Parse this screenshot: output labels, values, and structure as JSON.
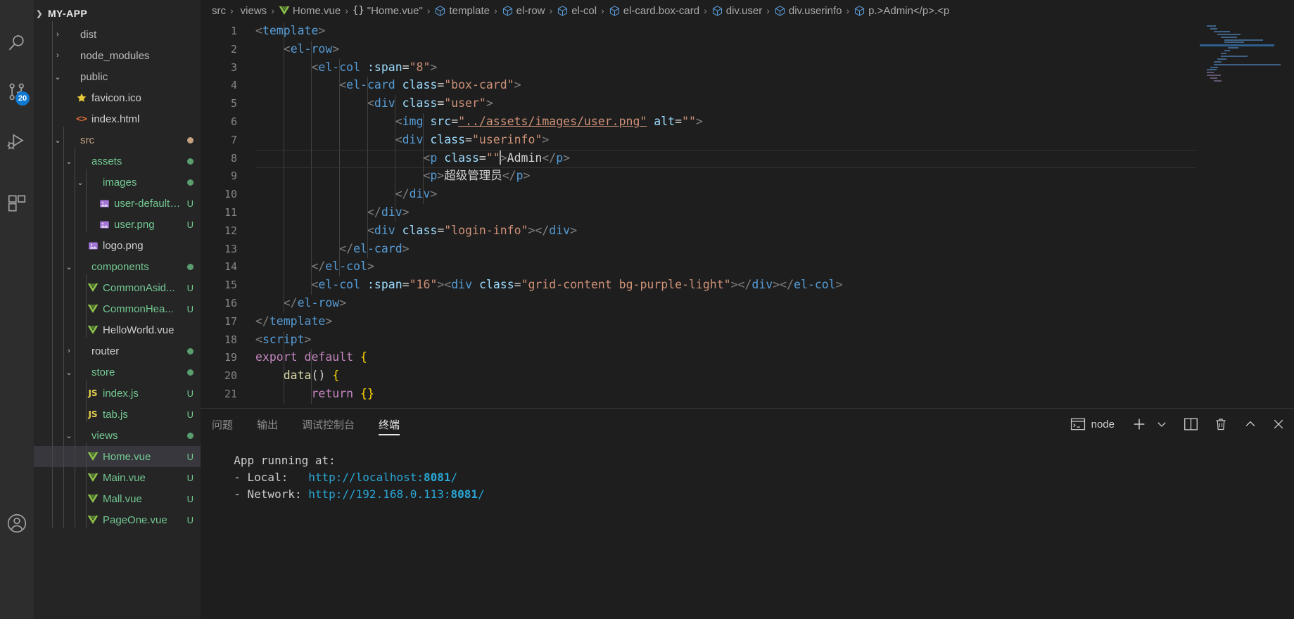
{
  "activity_bar": {
    "items": [
      {
        "name": "explorer",
        "icon": "files-icon",
        "badge": ""
      },
      {
        "name": "search",
        "icon": "search-icon",
        "badge": ""
      },
      {
        "name": "source-control",
        "icon": "source-control-icon",
        "badge": "20"
      },
      {
        "name": "run-and-debug",
        "icon": "run-debug-icon",
        "badge": ""
      },
      {
        "name": "extensions",
        "icon": "extensions-icon",
        "badge": ""
      }
    ],
    "account": {
      "name": "account",
      "icon": "account-icon"
    }
  },
  "explorer": {
    "root_label": "MY-APP",
    "items": [
      {
        "label": "dist",
        "indent": 1,
        "twisty": "collapsed",
        "icon": "folder-icon",
        "color": "#bdbdbd",
        "git": "",
        "dot": ""
      },
      {
        "label": "node_modules",
        "indent": 1,
        "twisty": "collapsed",
        "icon": "folder-icon",
        "color": "#bdbdbd",
        "git": "",
        "dot": ""
      },
      {
        "label": "public",
        "indent": 1,
        "twisty": "expanded",
        "icon": "folder-icon",
        "color": "#bdbdbd",
        "git": "",
        "dot": ""
      },
      {
        "label": "favicon.ico",
        "indent": 2,
        "twisty": "none",
        "icon": "star-icon",
        "color": "#cfcfcf",
        "git": "",
        "dot": ""
      },
      {
        "label": "index.html",
        "indent": 2,
        "twisty": "none",
        "icon": "html-icon",
        "color": "#cfcfcf",
        "git": "",
        "dot": ""
      },
      {
        "label": "src",
        "indent": 1,
        "twisty": "expanded",
        "icon": "folder-icon",
        "color": "#c5a180",
        "git": "",
        "dot": "#c5a180"
      },
      {
        "label": "assets",
        "indent": 2,
        "twisty": "expanded",
        "icon": "folder-icon",
        "color": "#73c991",
        "git": "",
        "dot": "#5a9e6f"
      },
      {
        "label": "images",
        "indent": 3,
        "twisty": "expanded",
        "icon": "folder-icon",
        "color": "#73c991",
        "git": "",
        "dot": "#5a9e6f"
      },
      {
        "label": "user-default....",
        "indent": 4,
        "twisty": "none",
        "icon": "image-icon",
        "color": "#73c991",
        "git": "U",
        "dot": ""
      },
      {
        "label": "user.png",
        "indent": 4,
        "twisty": "none",
        "icon": "image-icon",
        "color": "#73c991",
        "git": "U",
        "dot": ""
      },
      {
        "label": "logo.png",
        "indent": 3,
        "twisty": "none",
        "icon": "image-icon",
        "color": "#cfcfcf",
        "git": "",
        "dot": ""
      },
      {
        "label": "components",
        "indent": 2,
        "twisty": "expanded",
        "icon": "folder-icon",
        "color": "#73c991",
        "git": "",
        "dot": "#5a9e6f"
      },
      {
        "label": "CommonAsid...",
        "indent": 3,
        "twisty": "none",
        "icon": "vue-icon",
        "color": "#73c991",
        "git": "U",
        "dot": ""
      },
      {
        "label": "CommonHea...",
        "indent": 3,
        "twisty": "none",
        "icon": "vue-icon",
        "color": "#73c991",
        "git": "U",
        "dot": ""
      },
      {
        "label": "HelloWorld.vue",
        "indent": 3,
        "twisty": "none",
        "icon": "vue-icon",
        "color": "#cfcfcf",
        "git": "",
        "dot": ""
      },
      {
        "label": "router",
        "indent": 2,
        "twisty": "collapsed",
        "icon": "folder-icon",
        "color": "#cfcfcf",
        "git": "",
        "dot": "#5a9e6f"
      },
      {
        "label": "store",
        "indent": 2,
        "twisty": "expanded",
        "icon": "folder-icon",
        "color": "#73c991",
        "git": "",
        "dot": "#5a9e6f"
      },
      {
        "label": "index.js",
        "indent": 3,
        "twisty": "none",
        "icon": "js-icon",
        "color": "#73c991",
        "git": "U",
        "dot": ""
      },
      {
        "label": "tab.js",
        "indent": 3,
        "twisty": "none",
        "icon": "js-icon",
        "color": "#73c991",
        "git": "U",
        "dot": ""
      },
      {
        "label": "views",
        "indent": 2,
        "twisty": "expanded",
        "icon": "folder-icon",
        "color": "#73c991",
        "git": "",
        "dot": "#5a9e6f"
      },
      {
        "label": "Home.vue",
        "indent": 3,
        "twisty": "none",
        "icon": "vue-icon",
        "color": "#73c991",
        "git": "U",
        "dot": "",
        "selected": true
      },
      {
        "label": "Main.vue",
        "indent": 3,
        "twisty": "none",
        "icon": "vue-icon",
        "color": "#73c991",
        "git": "U",
        "dot": ""
      },
      {
        "label": "Mall.vue",
        "indent": 3,
        "twisty": "none",
        "icon": "vue-icon",
        "color": "#73c991",
        "git": "U",
        "dot": ""
      },
      {
        "label": "PageOne.vue",
        "indent": 3,
        "twisty": "none",
        "icon": "vue-icon",
        "color": "#73c991",
        "git": "U",
        "dot": ""
      }
    ]
  },
  "breadcrumb": [
    {
      "label": "src",
      "icon": ""
    },
    {
      "label": "views",
      "icon": ""
    },
    {
      "label": "Home.vue",
      "icon": "vue-icon"
    },
    {
      "label": "\"Home.vue\"",
      "icon": "braces-icon"
    },
    {
      "label": "template",
      "icon": "symbol-field-icon"
    },
    {
      "label": "el-row",
      "icon": "symbol-field-icon"
    },
    {
      "label": "el-col",
      "icon": "symbol-field-icon"
    },
    {
      "label": "el-card.box-card",
      "icon": "symbol-field-icon"
    },
    {
      "label": "div.user",
      "icon": "symbol-field-icon"
    },
    {
      "label": "div.userinfo",
      "icon": "symbol-field-icon"
    },
    {
      "label": "p.>Admin</p>.<p",
      "icon": "symbol-field-icon"
    }
  ],
  "editor": {
    "language": "vue",
    "cursor_line": 8,
    "lines": [
      {
        "n": "1",
        "text": "<template>"
      },
      {
        "n": "2",
        "text": "    <el-row>"
      },
      {
        "n": "3",
        "text": "        <el-col :span=\"8\">"
      },
      {
        "n": "4",
        "text": "            <el-card class=\"box-card\">"
      },
      {
        "n": "5",
        "text": "                <div class=\"user\">"
      },
      {
        "n": "6",
        "text": "                    <img src=\"../assets/images/user.png\" alt=\"\">"
      },
      {
        "n": "7",
        "text": "                    <div class=\"userinfo\">"
      },
      {
        "n": "8",
        "text": "                        <p class=\"\">Admin</p>"
      },
      {
        "n": "9",
        "text": "                        <p>超级管理员</p>"
      },
      {
        "n": "10",
        "text": "                    </div>"
      },
      {
        "n": "11",
        "text": "                </div>"
      },
      {
        "n": "12",
        "text": "                <div class=\"login-info\"></div>"
      },
      {
        "n": "13",
        "text": "            </el-card>"
      },
      {
        "n": "14",
        "text": "        </el-col>"
      },
      {
        "n": "15",
        "text": "        <el-col :span=\"16\"><div class=\"grid-content bg-purple-light\"></div></el-col>"
      },
      {
        "n": "16",
        "text": "    </el-row>"
      },
      {
        "n": "17",
        "text": "</template>"
      },
      {
        "n": "18",
        "text": "<script>"
      },
      {
        "n": "19",
        "text": "export default {"
      },
      {
        "n": "20",
        "text": "    data() {"
      },
      {
        "n": "21",
        "text": "        return {}"
      }
    ]
  },
  "panel": {
    "tabs": [
      {
        "label": "问题",
        "active": false
      },
      {
        "label": "输出",
        "active": false
      },
      {
        "label": "调试控制台",
        "active": false
      },
      {
        "label": "终端",
        "active": true
      }
    ],
    "actions": [
      {
        "name": "terminal-selector",
        "icon": "console-icon",
        "label": "node"
      },
      {
        "name": "new-terminal",
        "icon": "plus-icon",
        "label": ""
      },
      {
        "name": "terminal-dropdown",
        "icon": "chevron-down-icon",
        "label": ""
      },
      {
        "name": "split-terminal",
        "icon": "split-icon",
        "label": ""
      },
      {
        "name": "kill-terminal",
        "icon": "trash-icon",
        "label": ""
      },
      {
        "name": "collapse-panel",
        "icon": "chevron-up-icon",
        "label": ""
      },
      {
        "name": "close-panel",
        "icon": "close-icon",
        "label": ""
      }
    ],
    "terminal_lines": [
      {
        "prefix": "  App running at:",
        "url": "",
        "port": "",
        "suffix": ""
      },
      {
        "prefix": "  - Local:   ",
        "url": "http://localhost:",
        "port": "8081",
        "suffix": "/"
      },
      {
        "prefix": "  - Network: ",
        "url": "http://192.168.0.113:",
        "port": "8081",
        "suffix": "/"
      }
    ]
  },
  "colors": {
    "accent": "#0e7ad4",
    "editor_bg": "#1e1e1e",
    "sidebar_bg": "#252526",
    "activitybar_bg": "#2d2d2d",
    "selection_bg": "#37373d",
    "tag": "#569cd6",
    "attr": "#9cdcfe",
    "string": "#ce9178",
    "keyword": "#c586c0",
    "number": "#b5cea8",
    "terminal_link": "#2aa7d6",
    "git_untracked": "#73c991"
  }
}
